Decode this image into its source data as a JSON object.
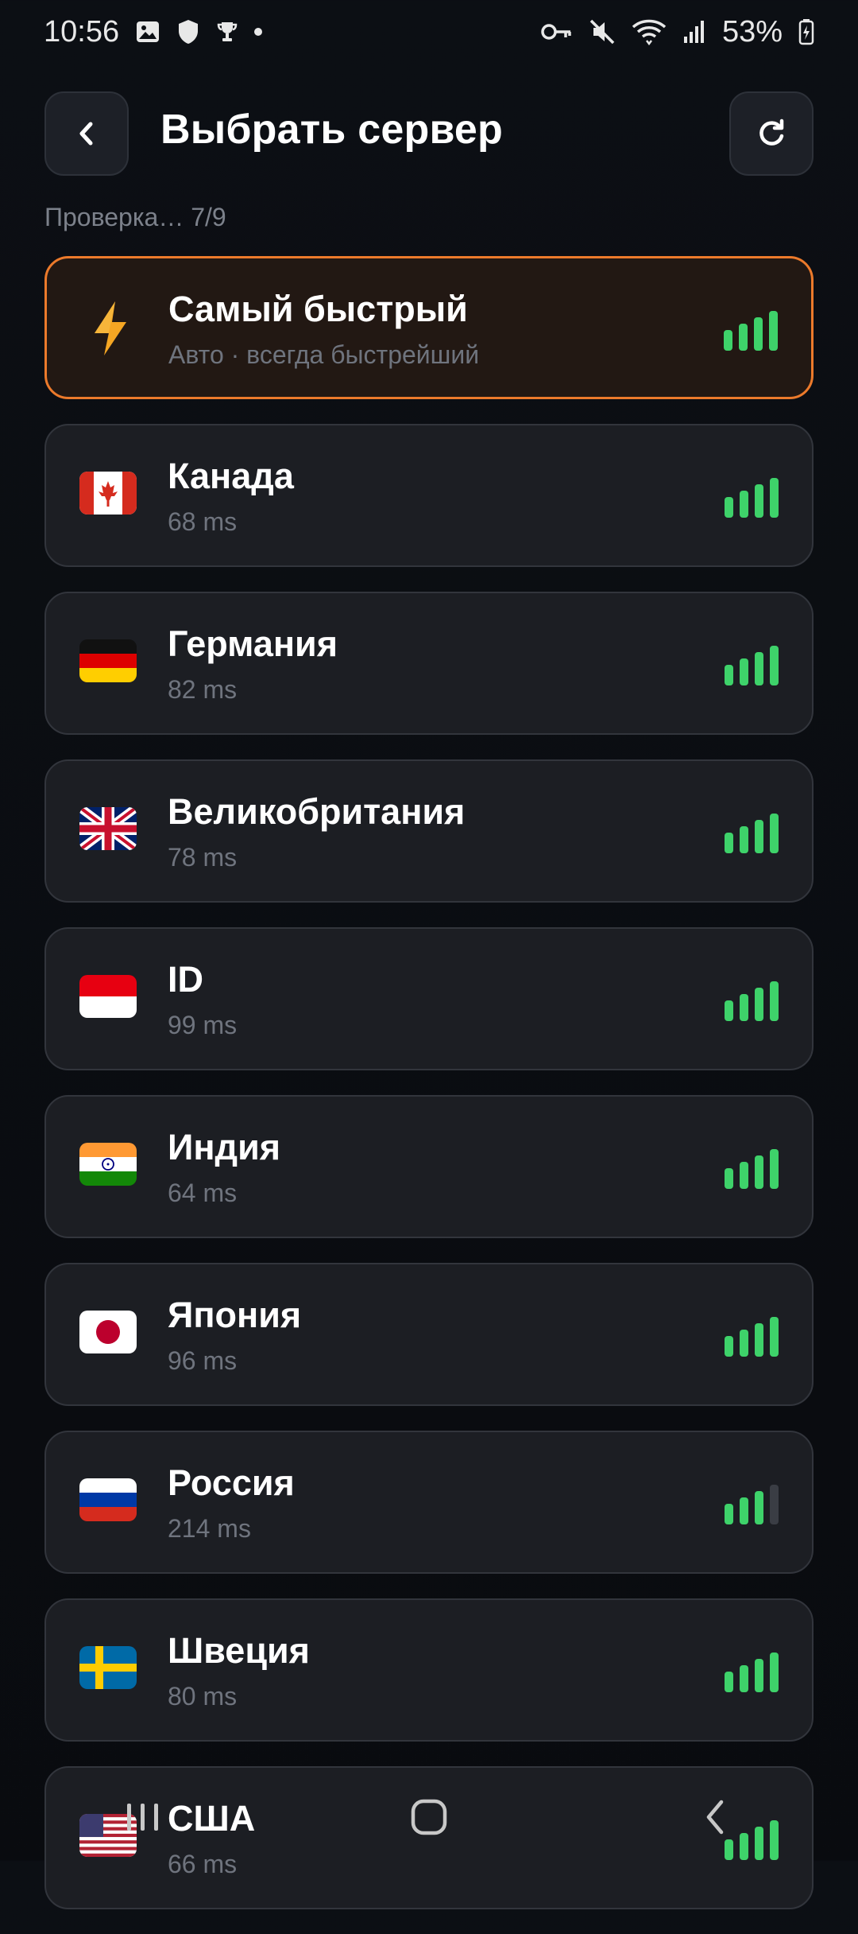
{
  "status": {
    "time": "10:56",
    "battery": "53%"
  },
  "header": {
    "title": "Выбрать сервер",
    "subtitle": "Проверка… 7/9"
  },
  "fastest": {
    "name": "Самый быстрый",
    "sub": "Авто · всегда быстрейший",
    "signal_bars": 4
  },
  "servers": [
    {
      "name": "Канада",
      "ping": "68 ms",
      "flag": "ca",
      "signal_bars": 4
    },
    {
      "name": "Германия",
      "ping": "82 ms",
      "flag": "de",
      "signal_bars": 4
    },
    {
      "name": "Великобритания",
      "ping": "78 ms",
      "flag": "gb",
      "signal_bars": 4
    },
    {
      "name": "ID",
      "ping": "99 ms",
      "flag": "id",
      "signal_bars": 4
    },
    {
      "name": "Индия",
      "ping": "64 ms",
      "flag": "in",
      "signal_bars": 4
    },
    {
      "name": "Япония",
      "ping": "96 ms",
      "flag": "jp",
      "signal_bars": 4
    },
    {
      "name": "Россия",
      "ping": "214 ms",
      "flag": "ru",
      "signal_bars": 3
    },
    {
      "name": "Швеция",
      "ping": "80 ms",
      "flag": "se",
      "signal_bars": 4
    },
    {
      "name": "США",
      "ping": "66 ms",
      "flag": "us",
      "signal_bars": 4
    }
  ],
  "colors": {
    "accent": "#ec7a2b",
    "signal_on": "#3ed26a",
    "signal_off": "#3a3d44",
    "card_bg": "#1c1e23"
  }
}
